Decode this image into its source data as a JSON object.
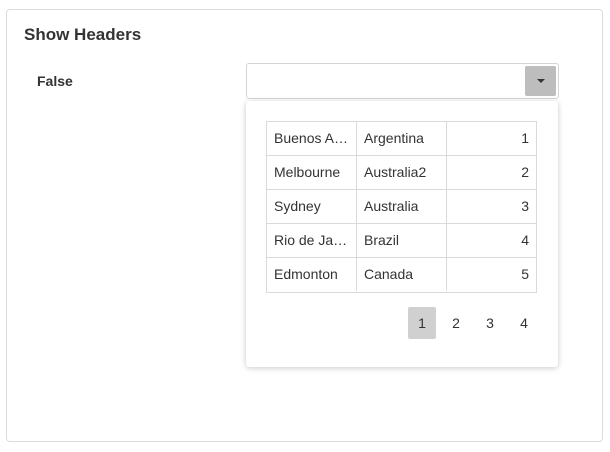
{
  "panel": {
    "title": "Show Headers"
  },
  "field": {
    "label": "False",
    "value": ""
  },
  "dropdown": {
    "rows": [
      {
        "city": "Buenos Aires",
        "country": "Argentina",
        "id": "1"
      },
      {
        "city": "Melbourne",
        "country": "Australia2",
        "id": "2"
      },
      {
        "city": "Sydney",
        "country": "Australia",
        "id": "3"
      },
      {
        "city": "Rio de Janeiro",
        "country": "Brazil",
        "id": "4"
      },
      {
        "city": "Edmonton",
        "country": "Canada",
        "id": "5"
      }
    ],
    "pager": {
      "pages": [
        "1",
        "2",
        "3",
        "4"
      ],
      "active_page": "1"
    }
  },
  "colors": {
    "border": "#dcdcdc",
    "active_page_bg": "#d0d0d0",
    "button_bg": "#bdbdbd"
  },
  "icons": {
    "dropdown_toggle": "caret-down-icon"
  }
}
